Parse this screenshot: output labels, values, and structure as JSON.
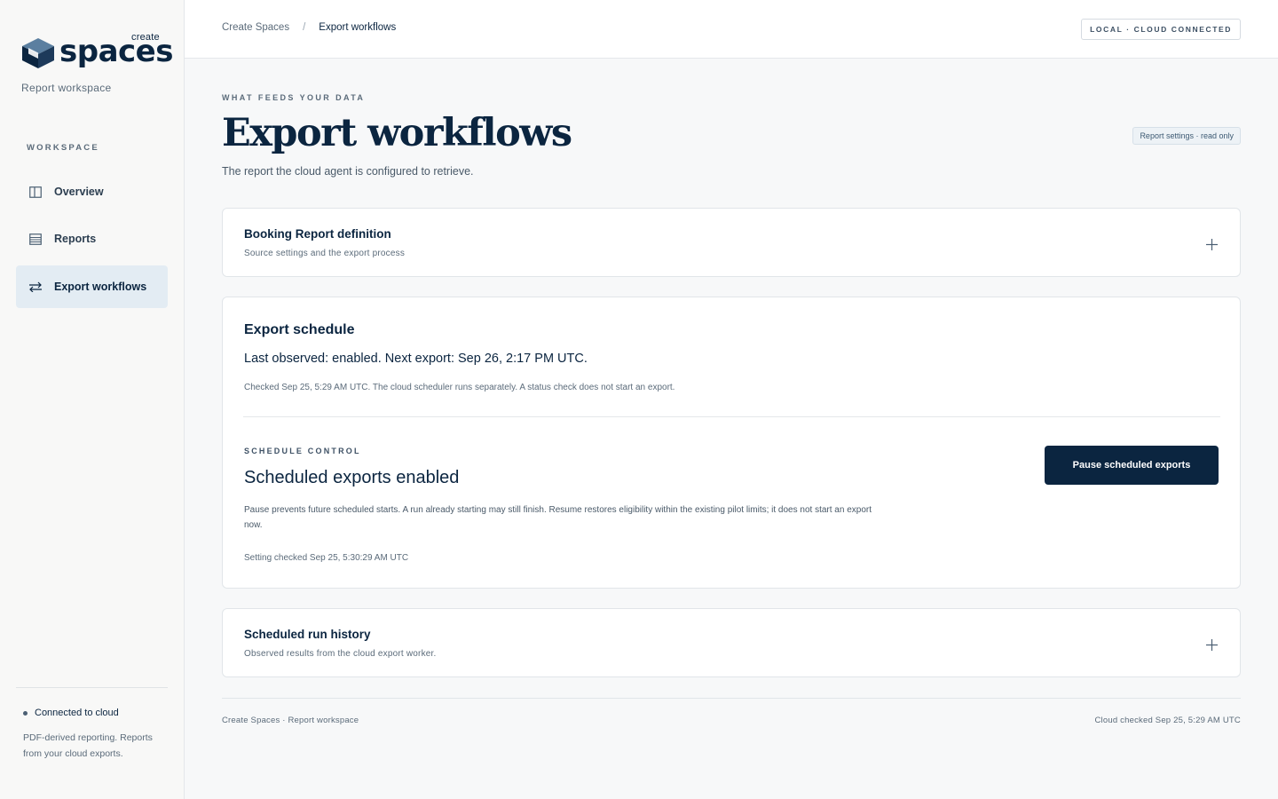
{
  "brand": {
    "create_label": "create",
    "wordmark": "spaces",
    "subtitle": "Report workspace"
  },
  "sidebar": {
    "heading": "WORKSPACE",
    "items": [
      {
        "label": "Overview",
        "icon": "panel-icon",
        "active": false
      },
      {
        "label": "Reports",
        "icon": "list-icon",
        "active": false
      },
      {
        "label": "Export workflows",
        "icon": "swap-arrows-icon",
        "active": true
      }
    ],
    "connection_status": "Connected to cloud",
    "note": "PDF-derived reporting. Reports from your cloud exports."
  },
  "topbar": {
    "breadcrumb_root": "Create Spaces",
    "breadcrumb_separator": "/",
    "breadcrumb_current": "Export workflows",
    "connection_badge": "LOCAL · CLOUD CONNECTED"
  },
  "page": {
    "eyebrow": "WHAT FEEDS YOUR DATA",
    "title": "Export workflows",
    "subtitle": "The report the cloud agent is configured to retrieve.",
    "settings_badge": "Report settings · read only"
  },
  "definition_card": {
    "title": "Booking Report definition",
    "subtitle": "Source settings and the export process"
  },
  "schedule_card": {
    "title": "Export schedule",
    "observed": "Last observed: enabled. Next export: Sep 26, 2:17 PM UTC.",
    "checked_note": "Checked Sep 25, 5:29 AM UTC. The cloud scheduler runs separately. A status check does not start an export.",
    "control_eyebrow": "SCHEDULE CONTROL",
    "control_state": "Scheduled exports enabled",
    "control_description": "Pause prevents future scheduled starts. A run already starting may still finish. Resume restores eligibility within the existing pilot limits; it does not start an export now.",
    "setting_checked": "Setting checked Sep 25, 5:30:29 AM UTC",
    "pause_button": "Pause scheduled exports"
  },
  "history_card": {
    "title": "Scheduled run history",
    "subtitle": "Observed results from the cloud export worker."
  },
  "footer": {
    "left": "Create Spaces · Report workspace",
    "right": "Cloud checked Sep 25, 5:29 AM UTC"
  },
  "colors": {
    "primary": "#0b2540",
    "active_nav_bg": "#e3ecf3",
    "page_bg": "#f7f8f9"
  }
}
